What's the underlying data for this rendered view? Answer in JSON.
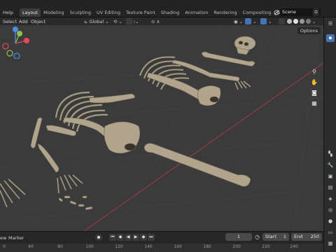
{
  "menu": {
    "help": "Help"
  },
  "workspaces": [
    "Layout",
    "Modeling",
    "Sculpting",
    "UV Editing",
    "Texture Paint",
    "Shading",
    "Animation",
    "Rendering",
    "Compositing",
    "Geometry Noc"
  ],
  "active_workspace": "Layout",
  "scene": {
    "name": "Scene"
  },
  "editor_header": {
    "select": "Select",
    "add": "Add",
    "object": "Object",
    "transform_orientation": "Global"
  },
  "viewport": {
    "options_label": "Options"
  },
  "gizmo_axes": {
    "x": "X",
    "y": "Y",
    "z": "Z"
  },
  "timeline": {
    "view_label": "ew",
    "marker": "Marker",
    "current_frame": "1",
    "start_label": "Start",
    "start_frame": "1",
    "end_label": "End",
    "end_frame": "250",
    "ruler_ticks": [
      "0",
      "40",
      "80",
      "100",
      "120",
      "140",
      "160",
      "180",
      "200",
      "220",
      "240"
    ]
  },
  "colors": {
    "accent": "#4772b3",
    "viewport_bg": "#3b3b3b",
    "bone": "#b0a58c",
    "axis_x": "#e8485c",
    "axis_y": "#8bc34a",
    "axis_z": "#4a90e2"
  },
  "icons": [
    "search-icon",
    "hand-icon",
    "camera-icon",
    "grid-icon",
    "zoom-icon",
    "record-icon",
    "clock-icon",
    "scene-icon"
  ]
}
